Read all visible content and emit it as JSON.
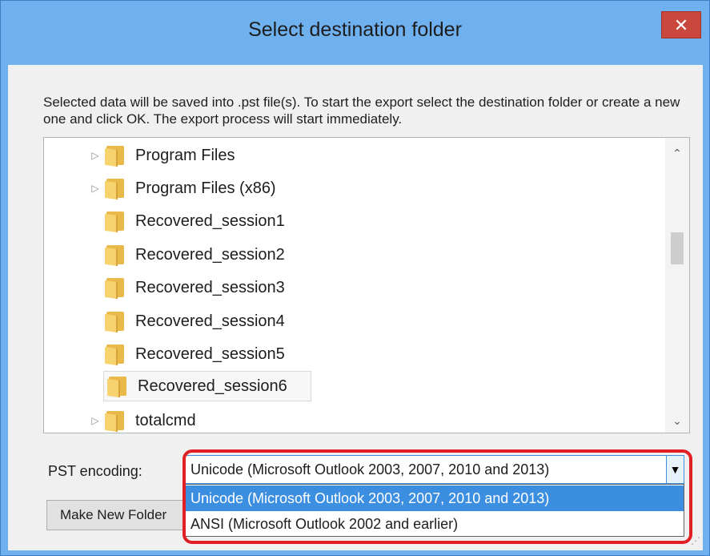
{
  "window": {
    "title": "Select destination folder",
    "close_glyph": "✕"
  },
  "description": "Selected data will be saved into .pst file(s). To start the export select the destination folder or create a new one and click OK. The export process will start immediately.",
  "tree": {
    "items": [
      {
        "label": "Program Files",
        "expandable": true
      },
      {
        "label": "Program Files (x86)",
        "expandable": true
      },
      {
        "label": "Recovered_session1",
        "expandable": false
      },
      {
        "label": "Recovered_session2",
        "expandable": false
      },
      {
        "label": "Recovered_session3",
        "expandable": false
      },
      {
        "label": "Recovered_session4",
        "expandable": false
      },
      {
        "label": "Recovered_session5",
        "expandable": false
      },
      {
        "label": "Recovered_session6",
        "expandable": false,
        "selected": true
      },
      {
        "label": "totalcmd",
        "expandable": true
      }
    ],
    "expander_glyph": "▷",
    "scroll_up_glyph": "⌃",
    "scroll_down_glyph": "⌄"
  },
  "encoding": {
    "label": "PST encoding:",
    "selected_value": "Unicode (Microsoft Outlook 2003, 2007, 2010 and 2013)",
    "arrow_glyph": "▼",
    "options": [
      {
        "label": "Unicode (Microsoft Outlook 2003, 2007, 2010 and 2013)",
        "highlighted": true
      },
      {
        "label": "ANSI (Microsoft Outlook 2002 and earlier)",
        "highlighted": false
      }
    ]
  },
  "buttons": {
    "make_new_folder": "Make New Folder"
  },
  "colors": {
    "title_bar": "#6fb0ef",
    "close_button": "#c9473d",
    "highlight_option": "#3b8ee0",
    "annotation_ring": "#e02024"
  }
}
